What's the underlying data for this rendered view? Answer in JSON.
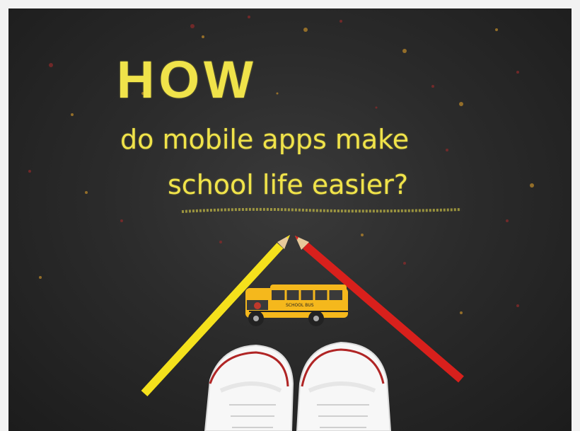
{
  "headline": {
    "word": "HOW",
    "line1": "do mobile apps make",
    "line2": "school life easier?"
  },
  "bus_label": "SCHOOL BUS",
  "colors": {
    "chalkboard": "#2b2b2b",
    "chalk_yellow": "#f0e34a",
    "pencil_yellow": "#f4e11c",
    "pencil_red": "#d8201c",
    "bus_yellow": "#f5b81c",
    "shoe_red": "#b02525"
  }
}
